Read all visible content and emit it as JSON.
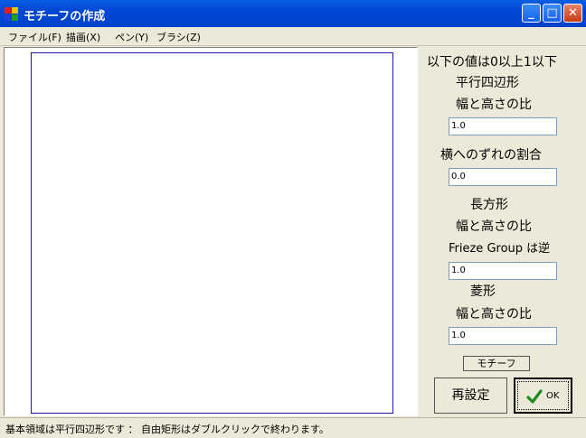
{
  "window": {
    "title": "モチーフの作成",
    "minimize": "_",
    "maximize": "□",
    "close": "✕"
  },
  "menu": [
    {
      "label": "ファイル(F)"
    },
    {
      "label": "描画(X)"
    },
    {
      "label": "ペン(Y)"
    },
    {
      "label": "ブラシ(Z)"
    }
  ],
  "panel": {
    "range_note": "以下の値は0以上1以下",
    "parallelogram_heading": "平行四辺形",
    "parallelogram_ratio_label": "幅と高さの比",
    "parallelogram_ratio_value": "1.0",
    "shift_label": "横へのずれの割合",
    "shift_value": "0.0",
    "rectangle_heading": "長方形",
    "rectangle_ratio_label": "幅と高さの比",
    "rectangle_note": "Frieze Group は逆",
    "rectangle_ratio_value": "1.0",
    "rhombus_heading": "菱形",
    "rhombus_ratio_label": "幅と高さの比",
    "rhombus_ratio_value": "1.0",
    "motif_button": "モチーフ",
    "reset_button": "再設定",
    "ok_button": "OK",
    "ok_icon": "check-icon"
  },
  "status": {
    "text": "基本領域は平行四辺形です ： 自由矩形はダブルクリックで終わります。"
  },
  "colors": {
    "titlebar": "#0046d5",
    "motif_border": "#1c1ca8",
    "check": "#1f8a1f"
  }
}
